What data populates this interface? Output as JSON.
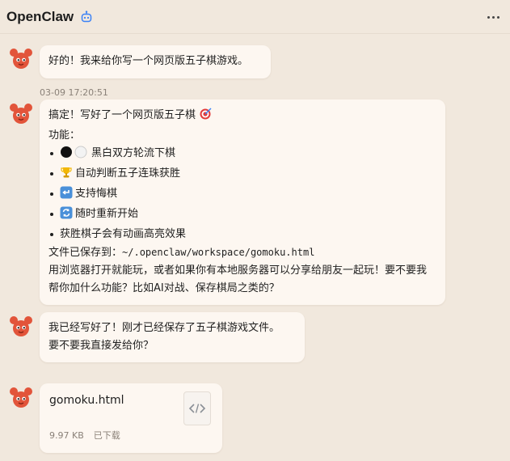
{
  "header": {
    "title": "OpenClaw",
    "bot_icon": "robot-icon",
    "more_icon": "more-horizontal-icon"
  },
  "messages": {
    "m1": {
      "text": "好的！我来给你写一个网页版五子棋游戏。"
    },
    "timestamp": "03-09 17:20:51",
    "m2": {
      "title": "搞定！写好了一个网页版五子棋",
      "title_emoji": "target-icon",
      "features_label": "功能：",
      "features": [
        {
          "icon": "black-white-stones-icon",
          "text": "黑白双方轮流下棋"
        },
        {
          "icon": "trophy-icon",
          "text": "自动判断五子连珠获胜"
        },
        {
          "icon": "undo-arrow-icon",
          "text": "支持悔棋"
        },
        {
          "icon": "refresh-icon",
          "text": "随时重新开始"
        },
        {
          "icon": "",
          "text": "获胜棋子会有动画高亮效果"
        }
      ],
      "saved_prefix": "文件已保存到：",
      "saved_path": "~/.openclaw/workspace/gomoku.html",
      "closing": "用浏览器打开就能玩，或者如果你有本地服务器可以分享给朋友一起玩！要不要我帮你加什么功能？比如AI对战、保存棋局之类的？"
    },
    "m3": {
      "line1": "我已经写好了！刚才已经保存了五子棋游戏文件。",
      "line2": "要不要我直接发给你？"
    },
    "m4": {
      "file_name": "gomoku.html",
      "file_size": "9.97 KB",
      "file_status": "已下载",
      "file_icon": "code-file-icon"
    }
  }
}
